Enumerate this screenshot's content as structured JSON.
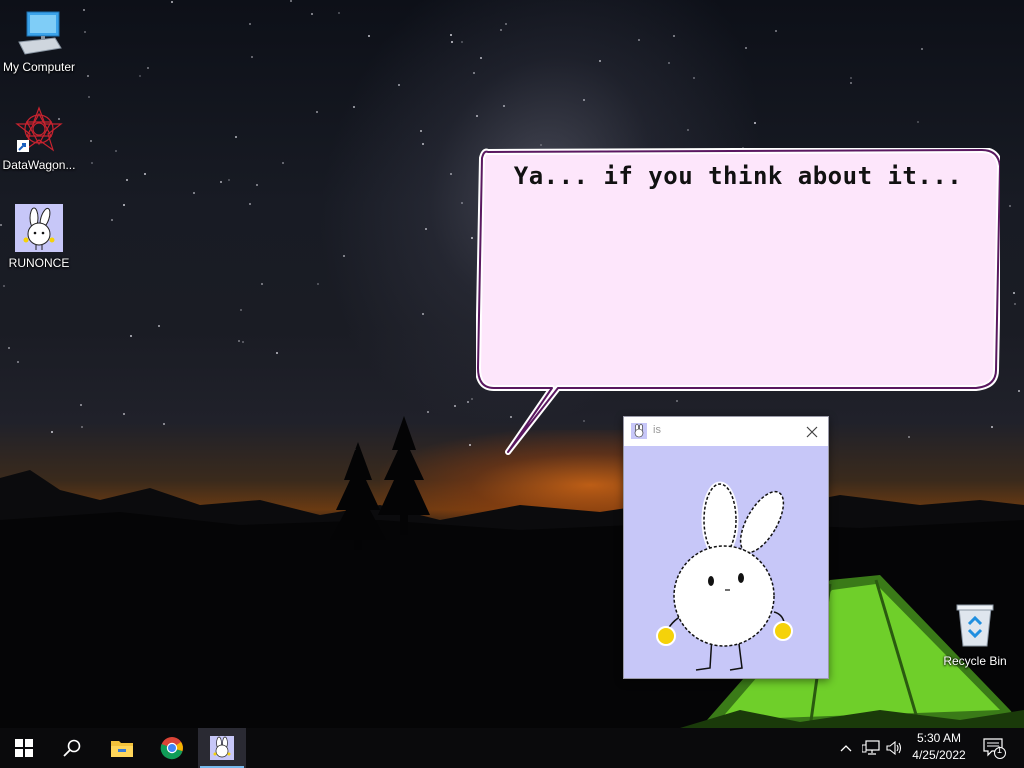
{
  "desktop": {
    "icons": [
      {
        "label": "My Computer",
        "icon": "computer-icon"
      },
      {
        "label": "DataWagon...",
        "icon": "datawagon-icon"
      },
      {
        "label": "RUNONCE",
        "icon": "bunny-icon"
      },
      {
        "label": "Recycle Bin",
        "icon": "recycle-bin-icon"
      }
    ]
  },
  "bubble": {
    "text": "Ya... if you think about it..."
  },
  "window": {
    "title": "is",
    "icon": "bunny-icon"
  },
  "taskbar": {
    "buttons": [
      "start-icon",
      "search-icon",
      "file-explorer-icon",
      "chrome-icon",
      "bunny-app-icon"
    ],
    "clock": {
      "time": "5:30 AM",
      "date": "4/25/2022"
    },
    "notification_count": "1"
  },
  "colors": {
    "bubble_fill": "#fde6fb",
    "bubble_border": "#5a1860",
    "window_client": "#c7c7f8",
    "bunny_hands": "#f5d20a",
    "taskbar_accent": "#76b9ed"
  }
}
